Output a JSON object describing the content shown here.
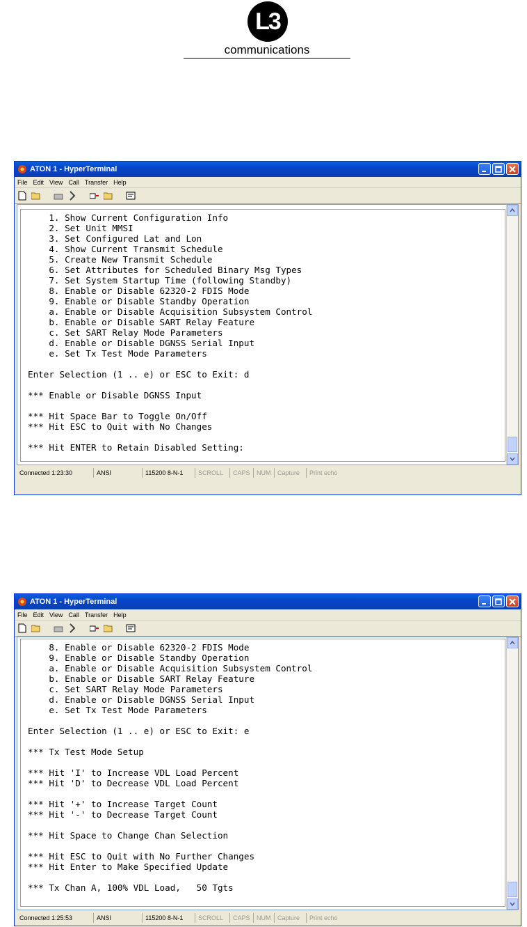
{
  "logo": {
    "mark": "L3",
    "text": "communications"
  },
  "windows": [
    {
      "title": "ATON 1 - HyperTerminal",
      "menu": [
        "File",
        "Edit",
        "View",
        "Call",
        "Transfer",
        "Help"
      ],
      "terminal_lines": [
        "    1. Show Current Configuration Info",
        "    2. Set Unit MMSI",
        "    3. Set Configured Lat and Lon",
        "    4. Show Current Transmit Schedule",
        "    5. Create New Transmit Schedule",
        "    6. Set Attributes for Scheduled Binary Msg Types",
        "    7. Set System Startup Time (following Standby)",
        "    8. Enable or Disable 62320-2 FDIS Mode",
        "    9. Enable or Disable Standby Operation",
        "    a. Enable or Disable Acquisition Subsystem Control",
        "    b. Enable or Disable SART Relay Feature",
        "    c. Set SART Relay Mode Parameters",
        "    d. Enable or Disable DGNSS Serial Input",
        "    e. Set Tx Test Mode Parameters",
        "",
        "Enter Selection (1 .. e) or ESC to Exit: d",
        "",
        "*** Enable or Disable DGNSS Input",
        "",
        "*** Hit Space Bar to Toggle On/Off",
        "*** Hit ESC to Quit with No Changes",
        "",
        "*** Hit ENTER to Retain Disabled Setting:"
      ],
      "status": [
        "Connected 1:23:30",
        "ANSI",
        "115200 8-N-1",
        "SCROLL",
        "CAPS",
        "NUM",
        "Capture",
        "Print echo"
      ]
    },
    {
      "title": "ATON 1 - HyperTerminal",
      "menu": [
        "File",
        "Edit",
        "View",
        "Call",
        "Transfer",
        "Help"
      ],
      "terminal_lines": [
        "    8. Enable or Disable 62320-2 FDIS Mode",
        "    9. Enable or Disable Standby Operation",
        "    a. Enable or Disable Acquisition Subsystem Control",
        "    b. Enable or Disable SART Relay Feature",
        "    c. Set SART Relay Mode Parameters",
        "    d. Enable or Disable DGNSS Serial Input",
        "    e. Set Tx Test Mode Parameters",
        "",
        "Enter Selection (1 .. e) or ESC to Exit: e",
        "",
        "*** Tx Test Mode Setup",
        "",
        "*** Hit 'I' to Increase VDL Load Percent",
        "*** Hit 'D' to Decrease VDL Load Percent",
        "",
        "*** Hit '+' to Increase Target Count",
        "*** Hit '-' to Decrease Target Count",
        "",
        "*** Hit Space to Change Chan Selection",
        "",
        "*** Hit ESC to Quit with No Further Changes",
        "*** Hit Enter to Make Specified Update",
        "",
        "*** Tx Chan A, 100% VDL Load,   50 Tgts"
      ],
      "status": [
        "Connected 1:25:53",
        "ANSI",
        "115200 8-N-1",
        "SCROLL",
        "CAPS",
        "NUM",
        "Capture",
        "Print echo"
      ]
    }
  ]
}
